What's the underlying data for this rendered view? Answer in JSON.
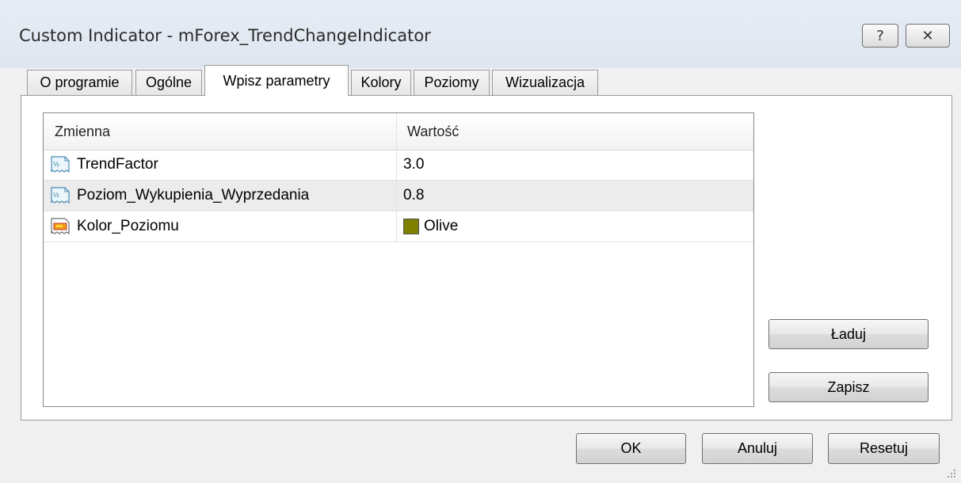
{
  "window": {
    "title": "Custom Indicator - mForex_TrendChangeIndicator",
    "help_glyph": "?",
    "close_glyph": "✕"
  },
  "tabs": [
    {
      "label": "O programie"
    },
    {
      "label": "Ogólne"
    },
    {
      "label": "Wpisz parametry",
      "active": true
    },
    {
      "label": "Kolory"
    },
    {
      "label": "Poziomy"
    },
    {
      "label": "Wizualizacja"
    }
  ],
  "grid": {
    "headers": {
      "variable": "Zmienna",
      "value": "Wartość"
    },
    "rows": [
      {
        "name": "TrendFactor",
        "value": "3.0",
        "icon": "number-param-icon"
      },
      {
        "name": "Poziom_Wykupienia_Wyprzedania",
        "value": "0.8",
        "icon": "number-param-icon"
      },
      {
        "name": "Kolor_Poziomu",
        "value": "Olive",
        "icon": "color-param-icon",
        "swatch_color": "#808000"
      }
    ]
  },
  "side_buttons": {
    "load": "Ładuj",
    "save": "Zapisz"
  },
  "footer_buttons": {
    "ok": "OK",
    "cancel": "Anuluj",
    "reset": "Resetuj"
  }
}
